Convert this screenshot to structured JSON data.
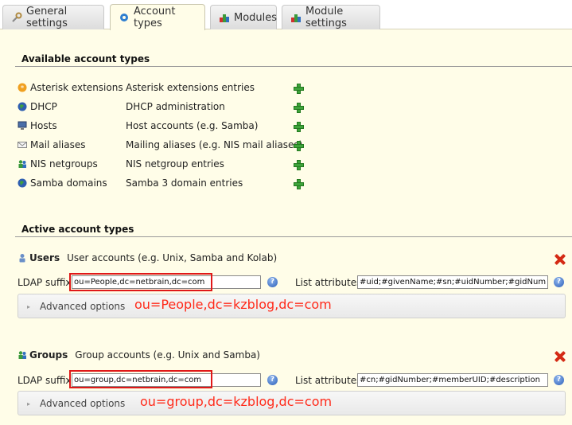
{
  "tabs": [
    {
      "label": "General settings",
      "icon": "wrench-icon",
      "active": false
    },
    {
      "label": "Account types",
      "icon": "gear-icon",
      "active": true
    },
    {
      "label": "Modules",
      "icon": "modules-icon",
      "active": false
    },
    {
      "label": "Module settings",
      "icon": "modules-icon",
      "active": false
    }
  ],
  "available": {
    "title": "Available account types",
    "items": [
      {
        "name": "Asterisk extensions",
        "desc": "Asterisk extensions entries",
        "icon": "asterisk-icon"
      },
      {
        "name": "DHCP",
        "desc": "DHCP administration",
        "icon": "globe-icon"
      },
      {
        "name": "Hosts",
        "desc": "Host accounts (e.g. Samba)",
        "icon": "computer-icon"
      },
      {
        "name": "Mail aliases",
        "desc": "Mailing aliases (e.g. NIS mail aliases)",
        "icon": "mail-icon"
      },
      {
        "name": "NIS netgroups",
        "desc": "NIS netgroup entries",
        "icon": "group-icon"
      },
      {
        "name": "Samba domains",
        "desc": "Samba 3 domain entries",
        "icon": "globe-icon"
      }
    ]
  },
  "active": {
    "title": "Active account types",
    "types": [
      {
        "name": "Users",
        "desc": "User accounts (e.g. Unix, Samba and Kolab)",
        "icon": "user-icon",
        "ldap_label": "LDAP suffix",
        "ldap_value": "ou=People,dc=netbrain,dc=com",
        "list_label": "List attributes",
        "list_value": "#uid;#givenName;#sn;#uidNumber;#gidNumber",
        "advanced": "Advanced options",
        "annotation": "ou=People,dc=kzblog,dc=com"
      },
      {
        "name": "Groups",
        "desc": "Group accounts (e.g. Unix and Samba)",
        "icon": "group-icon",
        "ldap_label": "LDAP suffix",
        "ldap_value": "ou=group,dc=netbrain,dc=com",
        "list_label": "List attributes",
        "list_value": "#cn;#gidNumber;#memberUID;#description",
        "advanced": "Advanced options",
        "annotation": "ou=group,dc=kzblog,dc=com"
      }
    ]
  },
  "colors": {
    "panel": "#fffde8",
    "add": "#3ea33a",
    "delete": "#d42a14",
    "annotation": "#ff2a1a",
    "highlight": "#e01818"
  }
}
